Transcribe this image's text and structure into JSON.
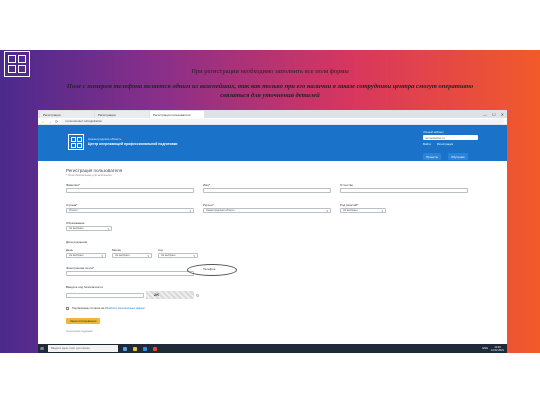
{
  "slide": {
    "main_caption": "При регистрации необходимо заполнить все поля формы",
    "italic_caption": "Поле с номером телефона является одним из важнейших, так как только при его наличии в заказе сотрудники центра смогут оперативно связаться для уточнения деталей",
    "colors": {
      "gradient_start": "#4a2a8c",
      "gradient_end": "#f25a2a"
    }
  },
  "browser": {
    "tabs": [
      "Регистрация",
      "Регистрация",
      "Регистрация пользователя"
    ],
    "window_controls": [
      "—",
      "☐",
      "✕"
    ],
    "url": "remontcenter.ru/registration",
    "icons": [
      "back-arrow-icon",
      "forward-arrow-icon",
      "reload-icon"
    ]
  },
  "site": {
    "region": "Нижегородская область",
    "center_name": "Центр опережающей профессиональной подготовки",
    "search_label": "Личный кабинет",
    "search_value": "remontcenter.ru",
    "header_links": [
      "Войти",
      "Регистрация"
    ],
    "header_buttons": [
      "Проекты",
      "Обучение"
    ]
  },
  "form": {
    "title": "Регистрация пользователя",
    "subtitle": "* Поля обязательные для заполнения",
    "surname_label": "Фамилия*",
    "name_label": "Имя*",
    "patronymic_label": "Отчество",
    "country_label": "Страна*",
    "country_value": "Россия",
    "region_label": "Регион*",
    "region_value": "Нижегородская область",
    "occupation_label": "Род занятий*",
    "occupation_value": "Не выбрано",
    "education_label": "Образование",
    "education_value": "Не выбрано",
    "birthdate_label": "Дата рождения",
    "day_label": "День",
    "day_value": "Не выбрано",
    "month_label": "Месяц",
    "month_value": "Не выбрано",
    "year_label": "Год",
    "year_value": "Не выбрано",
    "email_label": "Электронная почта*",
    "phone_label": "Телефон",
    "captcha_label": "Введите код безопасности",
    "captcha_text": "2K",
    "policy_text": "Подтверждаю согласие на",
    "policy_link": "обработку персональных данных",
    "submit_label": "Зарегистрироваться",
    "footnote": "Техническая поддержка"
  },
  "taskbar": {
    "search_placeholder": "Введите здесь текст для поиска",
    "tray": [
      "ENG"
    ],
    "time": "11:03",
    "date": "12.02.2021"
  }
}
